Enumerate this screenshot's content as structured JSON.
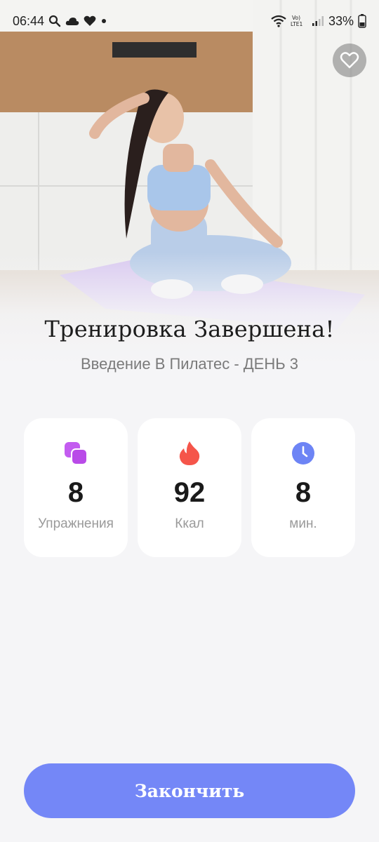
{
  "status_bar": {
    "time": "06:44",
    "battery": "33%",
    "network_label": "Vo) LTE1"
  },
  "hero": {
    "favorite_icon": "heart-outline-icon"
  },
  "header": {
    "title": "Тренировка Завершена!",
    "subtitle": "Введение В Пилатес - ДЕНЬ 3"
  },
  "stats": [
    {
      "icon": "exercises-icon",
      "value": "8",
      "label": "Упражнения",
      "color": "#c35cf0"
    },
    {
      "icon": "flame-icon",
      "value": "92",
      "label": "Ккал",
      "color": "#f5554a"
    },
    {
      "icon": "clock-icon",
      "value": "8",
      "label": "мин.",
      "color": "#6d84f5"
    }
  ],
  "actions": {
    "finish_label": "Закончить"
  },
  "colors": {
    "accent": "#7487f7",
    "background": "#f5f5f7",
    "card": "#ffffff"
  }
}
